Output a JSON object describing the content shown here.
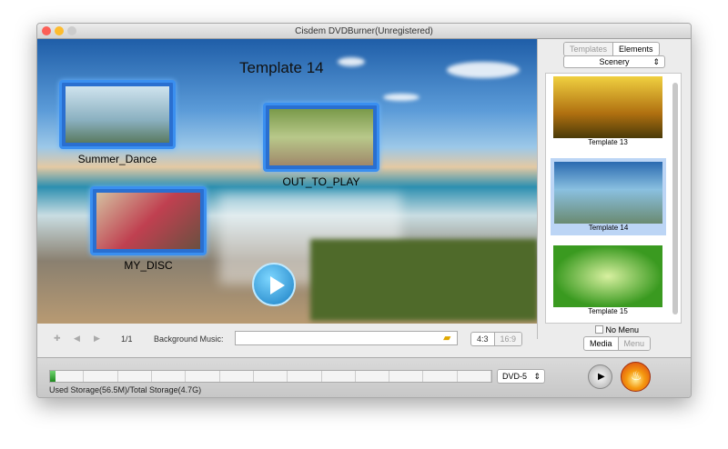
{
  "window": {
    "title": "Cisdem DVDBurner(Unregistered)"
  },
  "preview": {
    "title": "Template 14",
    "items": [
      {
        "label": "Summer_Dance"
      },
      {
        "label": "OUT_TO_PLAY"
      },
      {
        "label": "MY_DISC"
      }
    ]
  },
  "sidebar": {
    "tabs": [
      "Templates",
      "Elements"
    ],
    "category": "Scenery",
    "templates": [
      {
        "label": "Template 13"
      },
      {
        "label": "Template 14"
      },
      {
        "label": "Template 15"
      }
    ],
    "no_menu_label": "No Menu",
    "mode_tabs": [
      "Media",
      "Menu"
    ]
  },
  "toolbar": {
    "page": "1/1",
    "bg_music_label": "Background Music:",
    "bg_music_value": "",
    "aspect": [
      "4:3",
      "16:9"
    ]
  },
  "footer": {
    "storage_text": "Used Storage(56.5M)/Total Storage(4.7G)",
    "used_fraction": 0.012,
    "disc_type": "DVD-5"
  }
}
